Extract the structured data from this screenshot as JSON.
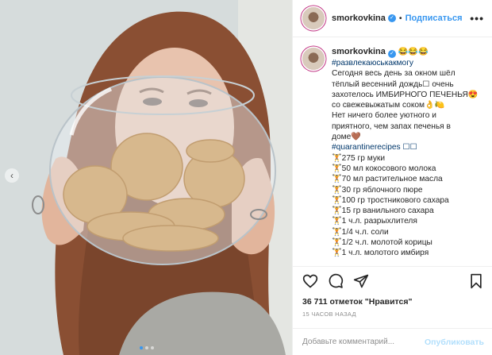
{
  "header": {
    "username": "smorkovkina",
    "separator": "•",
    "follow_label": "Подписаться",
    "more_label": "•••"
  },
  "caption": {
    "username": "smorkovkina",
    "emoji": "😂😂😂",
    "hashtag": "#развлекаюськакмогу",
    "lines": [
      "Сегодня весь день за окном шёл",
      "тёплый весенний дождь☐ очень",
      "захотелось ИМБИРНОГО ПЕЧЕНЬЯ😍",
      "со свежевыжатым соком👌🍋",
      "Нет ничего более уютного и",
      "приятного, чем запах печенья в",
      "доме🤎"
    ],
    "hashtag2": "#quarantinerecipes ☐☐",
    "ingredients": [
      "🏋275 гр муки",
      "🏋50 мл кокосового молока",
      "🏋70 мл растительное масла",
      "🏋30 гр яблочного пюре",
      "🏋100 гр тростникового сахара",
      "🏋15 гр ванильного сахара",
      "🏋1 ч.л. разрыхлителя",
      "🏋1/4 ч.л. соли",
      "🏋1/2 ч.л. молотой корицы",
      "🏋1 ч.л. молотого имбиря"
    ]
  },
  "icons": {
    "like": "heart-icon",
    "comment": "comment-icon",
    "share": "share-icon",
    "save": "bookmark-icon",
    "verified": "verified-badge-icon"
  },
  "likes_text": "36 711 отметок \"Нравится\"",
  "timestamp": "15 ЧАСОВ НАЗАД",
  "comment_box": {
    "placeholder": "Добавьте комментарий...",
    "publish_label": "Опубликовать"
  },
  "carousel": {
    "prev_label": "‹",
    "total": 3,
    "active_index": 1
  },
  "colors": {
    "accent": "#3897f0",
    "publish_disabled": "#b2dffc",
    "hashtag": "#00376b",
    "muted": "#8e8e8e"
  }
}
